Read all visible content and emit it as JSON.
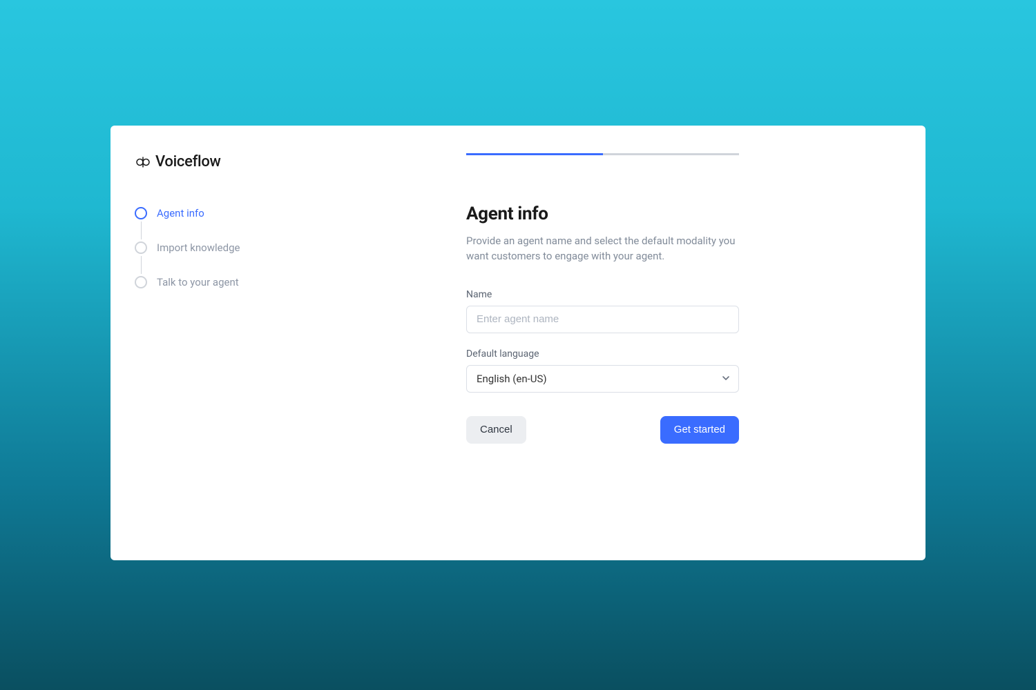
{
  "brand": {
    "name": "Voiceflow"
  },
  "steps": [
    {
      "label": "Agent info",
      "active": true
    },
    {
      "label": "Import knowledge",
      "active": false
    },
    {
      "label": "Talk to your agent",
      "active": false
    }
  ],
  "progress": {
    "percent": 50
  },
  "main": {
    "heading": "Agent info",
    "subtext": "Provide an agent name and select the default modality you want customers to engage with your agent.",
    "name_label": "Name",
    "name_placeholder": "Enter agent name",
    "name_value": "",
    "lang_label": "Default language",
    "lang_value": "English (en-US)"
  },
  "buttons": {
    "cancel": "Cancel",
    "primary": "Get started"
  },
  "colors": {
    "accent": "#3a6cff"
  }
}
